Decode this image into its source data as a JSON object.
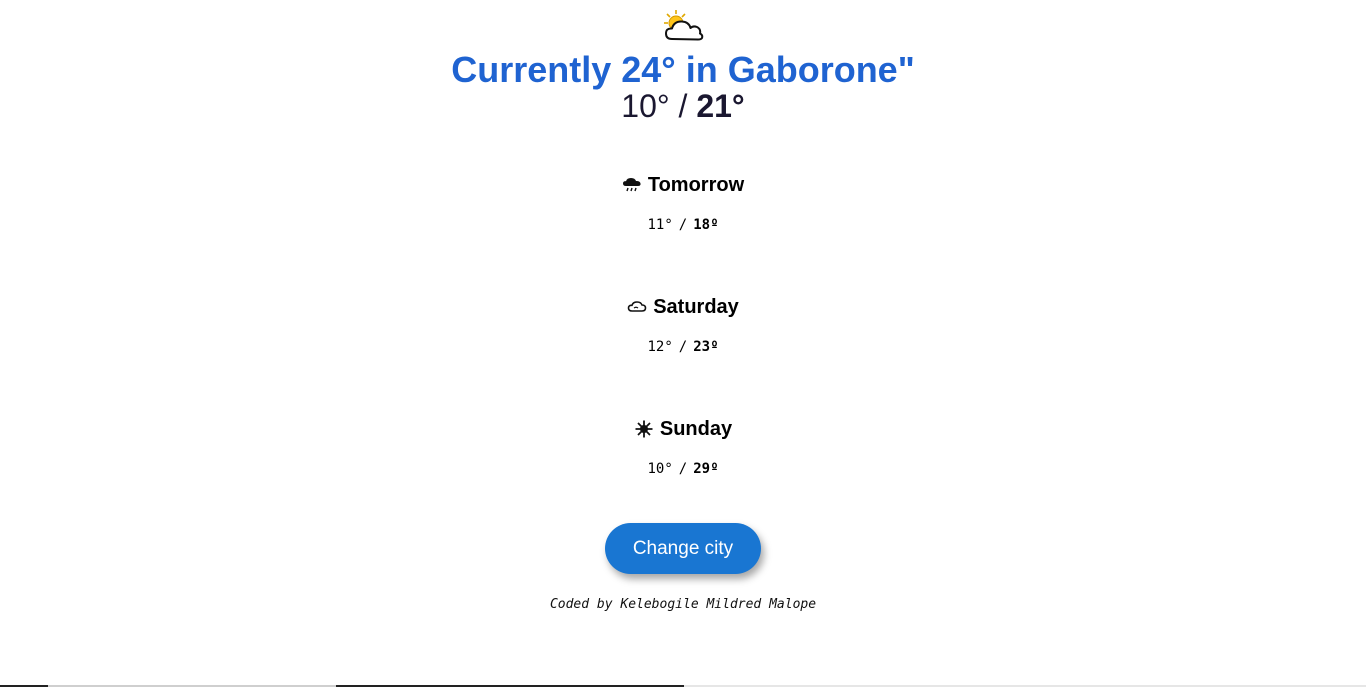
{
  "current": {
    "icon": "sun-behind-cloud-icon",
    "title": "Currently 24° in Gaborone\"",
    "low": "10°",
    "separator": "/",
    "high": "21°"
  },
  "forecast": [
    {
      "day": "Tomorrow",
      "icon": "rain-cloud-icon",
      "low": "11°",
      "separator": "/",
      "high": "18º"
    },
    {
      "day": "Saturday",
      "icon": "cloud-icon",
      "low": "12°",
      "separator": "/",
      "high": "23º"
    },
    {
      "day": "Sunday",
      "icon": "sun-icon",
      "low": "10°",
      "separator": "/",
      "high": "29º"
    }
  ],
  "button": {
    "label": "Change city"
  },
  "footer": {
    "credit": "Coded by Kelebogile Mildred Malope"
  },
  "colors": {
    "title": "#1f63d1",
    "button": "#1976d2"
  }
}
